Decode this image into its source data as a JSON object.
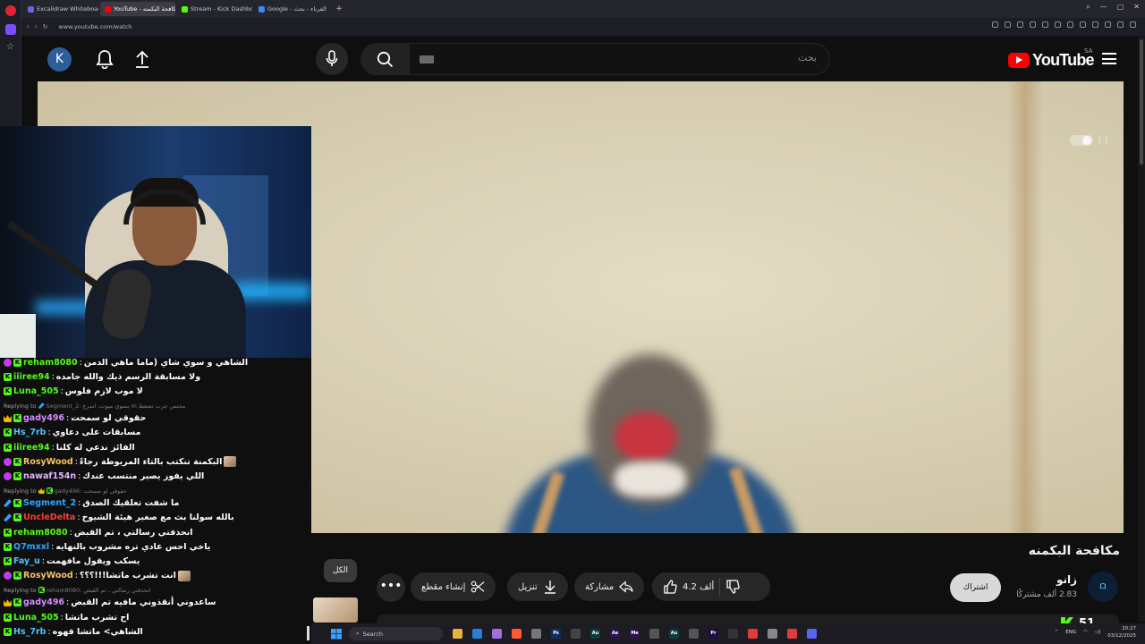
{
  "browser": {
    "tabs": [
      {
        "label": "Excalidraw Whiteboard",
        "color": "#6965db",
        "active": false
      },
      {
        "label": "YouTube - مكافحة البكمنه",
        "color": "#ff0000",
        "active": true
      },
      {
        "label": "Stream - Kick Dashboard",
        "color": "#53fc18",
        "active": false
      },
      {
        "label": "Google - الفرناء - بحث",
        "color": "#4285f4",
        "active": false
      }
    ],
    "new_tab": "+",
    "url": "www.youtube.com/watch"
  },
  "youtube": {
    "avatar_letter": "K",
    "search_placeholder": "بحث",
    "logo_text": "YouTube",
    "country_code": "SA",
    "video_title": "مكافحة البكمنه",
    "channel_name": "زانو",
    "channel_subs": "2.83 ألف مشتركًا",
    "subscribe_label": "اشتراك",
    "likes": "4.2 ألف",
    "share_label": "مشاركة",
    "download_label": "تنزيل",
    "clip_label": "إنشاء مقطع",
    "more_label": "•••",
    "chip_all": "الكل"
  },
  "chat": {
    "messages": [
      {
        "type": "msg",
        "badges": [
          "gem",
          "kb"
        ],
        "user": "reham8080",
        "user_color": "#53fc18",
        "text": "الشاهي و سوي شاي (ماما ماهي الدمن"
      },
      {
        "type": "msg",
        "badges": [
          "kb"
        ],
        "user": "iiiree94",
        "user_color": "#53fc18",
        "text": "ولا مسابقة الرسم ذيك والله جامده"
      },
      {
        "type": "msg",
        "badges": [
          "kb"
        ],
        "user": "Luna_505",
        "user_color": "#53fc18",
        "text": "لا موب لازم فلوس"
      },
      {
        "type": "reply",
        "prefix": "Replying to",
        "badges": [
          "tool"
        ],
        "user": "Segment_2:",
        "text": "يسوي ميوت، اسرع m محتس جرب تضغط"
      },
      {
        "type": "msg",
        "badges": [
          "crown",
          "kb"
        ],
        "user": "gady496",
        "user_color": "#d58cff",
        "text": "حقوقي لو سمحت"
      },
      {
        "type": "msg",
        "badges": [
          "kb"
        ],
        "user": "Hs_7rb",
        "user_color": "#4fc3ff",
        "text": "مسابقات على دعاوي"
      },
      {
        "type": "msg",
        "badges": [
          "kb"
        ],
        "user": "iiiree94",
        "user_color": "#53fc18",
        "text": "الفائز ندعي له كلنا"
      },
      {
        "type": "msg",
        "badges": [
          "gem",
          "kb"
        ],
        "user": "RosyWood",
        "user_color": "#f5c26b",
        "text": "البكمنة تنكتب بالتاء المربوطة رجاءً",
        "emote": true
      },
      {
        "type": "msg",
        "badges": [
          "gem",
          "kb"
        ],
        "user": "nawaf154n",
        "user_color": "#e7b3ff",
        "text": "اللي يفوز يصير منتسب عندك"
      },
      {
        "type": "reply",
        "prefix": "Replying to",
        "badges": [
          "crown",
          "kb"
        ],
        "user": "gady496:",
        "text": "حقوقي لو سمحت"
      },
      {
        "type": "msg",
        "badges": [
          "tool",
          "kb"
        ],
        "user": "Segment_2",
        "user_color": "#2ea6ff",
        "text": "ما شفت تعلقيك الصدق"
      },
      {
        "type": "msg",
        "badges": [
          "tool",
          "kb"
        ],
        "user": "UncleDelta",
        "user_color": "#ff3b3b",
        "text": "بالله سولنا بث مع صغير هيئة الشيوخ"
      },
      {
        "type": "msg",
        "badges": [
          "kb"
        ],
        "user": "reham8080",
        "user_color": "#53fc18",
        "text": "انحذفتي رسالتي ، تم القبض"
      },
      {
        "type": "msg",
        "badges": [
          "kb"
        ],
        "user": "Q7mxxl",
        "user_color": "#2ea6ff",
        "text": "ياخي احس عادي تره مشروب بالنهايه"
      },
      {
        "type": "msg",
        "badges": [
          "kb"
        ],
        "user": "Fay_u",
        "user_color": "#4fc3ff",
        "text": "يسكب ويقول مافهمت"
      },
      {
        "type": "msg",
        "badges": [
          "gem",
          "kb"
        ],
        "user": "RosyWood",
        "user_color": "#f5c26b",
        "text": "انت تشرب ماتشا!!!؟؟؟",
        "emote": true
      },
      {
        "type": "reply",
        "prefix": "Replying to",
        "badges": [
          "kb"
        ],
        "user": "reham8080:",
        "text": "انحذفتي رسالتي ، تم القبض"
      },
      {
        "type": "msg",
        "badges": [
          "crown",
          "kb"
        ],
        "user": "gady496",
        "user_color": "#d58cff",
        "text": "ساعدوني أنقذوني مافيه تم القبض"
      },
      {
        "type": "msg",
        "badges": [
          "kb"
        ],
        "user": "Luna_505",
        "user_color": "#53fc18",
        "text": "اح تشرب ماتشا"
      },
      {
        "type": "msg",
        "badges": [
          "kb"
        ],
        "user": "Hs_7rb",
        "user_color": "#4fc3ff",
        "text": "الشاهي> ماتشا قهوه"
      }
    ]
  },
  "kick": {
    "viewer_count": "51"
  },
  "taskbar": {
    "search_label": "Search",
    "apps": [
      {
        "label": "",
        "color": "#e8b23a"
      },
      {
        "label": "",
        "color": "#2a7fd4"
      },
      {
        "label": "",
        "color": "#a070e0"
      },
      {
        "label": "",
        "color": "#ff5b2e"
      },
      {
        "label": "",
        "color": "#777"
      },
      {
        "label": "Ps",
        "color": "#0f2f5e"
      },
      {
        "label": "",
        "color": "#444"
      },
      {
        "label": "Au",
        "color": "#0b3d3d"
      },
      {
        "label": "Ae",
        "color": "#2a1452"
      },
      {
        "label": "Me",
        "color": "#2a1452"
      },
      {
        "label": "",
        "color": "#555"
      },
      {
        "label": "Au",
        "color": "#0b3d3d"
      },
      {
        "label": "",
        "color": "#555"
      },
      {
        "label": "Pr",
        "color": "#1f0d40"
      },
      {
        "label": "",
        "color": "#333"
      },
      {
        "label": "",
        "color": "#e13b3b"
      },
      {
        "label": "",
        "color": "#888"
      },
      {
        "label": "",
        "color": "#e13b3b"
      },
      {
        "label": "",
        "color": "#5865f2"
      }
    ],
    "lang": "ENG",
    "time": "20:27",
    "date": "03/12/2025"
  }
}
